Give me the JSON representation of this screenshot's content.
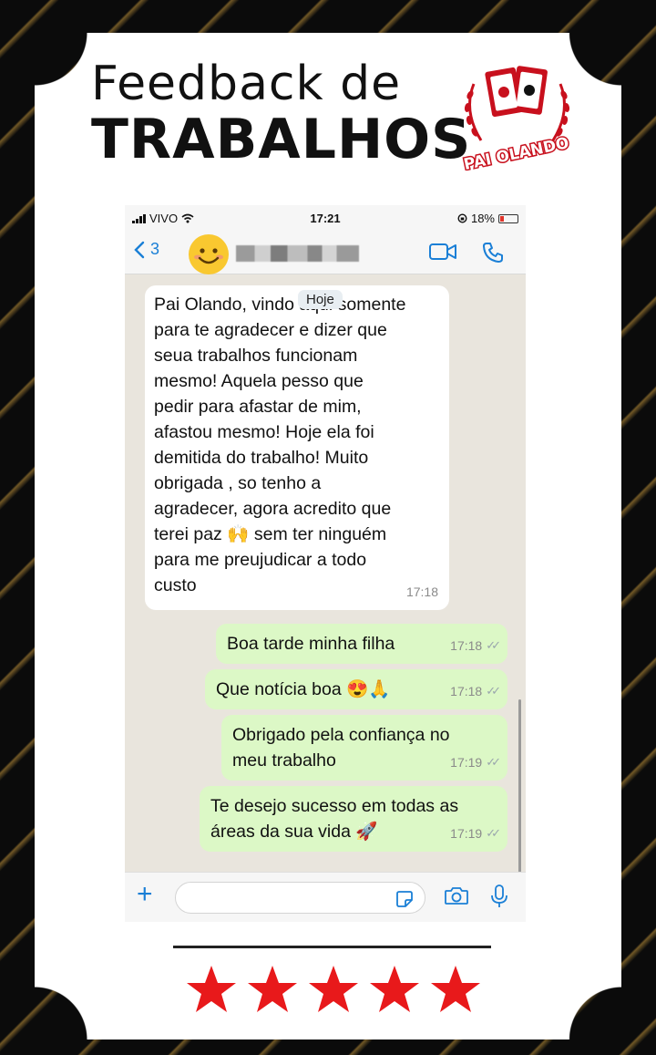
{
  "header": {
    "line1": "Feedback de",
    "line2": "TRABALHOS",
    "logo_text": "PAI OLANDO"
  },
  "status_bar": {
    "carrier": "VIVO",
    "time": "17:21",
    "battery": "18%"
  },
  "nav": {
    "back_count": "3"
  },
  "chat": {
    "date_chip": "Hoje",
    "messages": [
      {
        "direction": "incoming",
        "lines": [
          "Pai Olando, vindo aqui somente",
          "para te agradecer e dizer que",
          "seua trabalhos funcionam",
          "mesmo! Aquela pesso que",
          "pedir para afastar de mim,",
          "afastou mesmo! Hoje ela foi",
          "demitida do trabalho! Muito",
          "obrigada , so tenho a",
          "agradecer, agora acredito que",
          "terei paz 🙌 sem ter ninguém",
          "para me preujudicar a todo",
          "custo"
        ],
        "time": "17:18"
      },
      {
        "direction": "outgoing",
        "lines": [
          "Boa tarde minha filha"
        ],
        "time": "17:18"
      },
      {
        "direction": "outgoing",
        "lines": [
          "Que notícia boa 😍🙏"
        ],
        "time": "17:18"
      },
      {
        "direction": "outgoing",
        "lines": [
          "Obrigado pela confiança no",
          "meu trabalho"
        ],
        "time": "17:19"
      },
      {
        "direction": "outgoing",
        "lines": [
          "Te desejo sucesso em todas as",
          "áreas da sua vida 🚀"
        ],
        "time": "17:19"
      }
    ]
  },
  "rating": {
    "stars": 5,
    "max": 5,
    "star_color": "#e8191b"
  },
  "colors": {
    "outgoing_bubble": "#dcf8c6",
    "incoming_bubble": "#ffffff",
    "chat_background": "#e9e5dd",
    "ios_blue": "#1a7fd6"
  }
}
